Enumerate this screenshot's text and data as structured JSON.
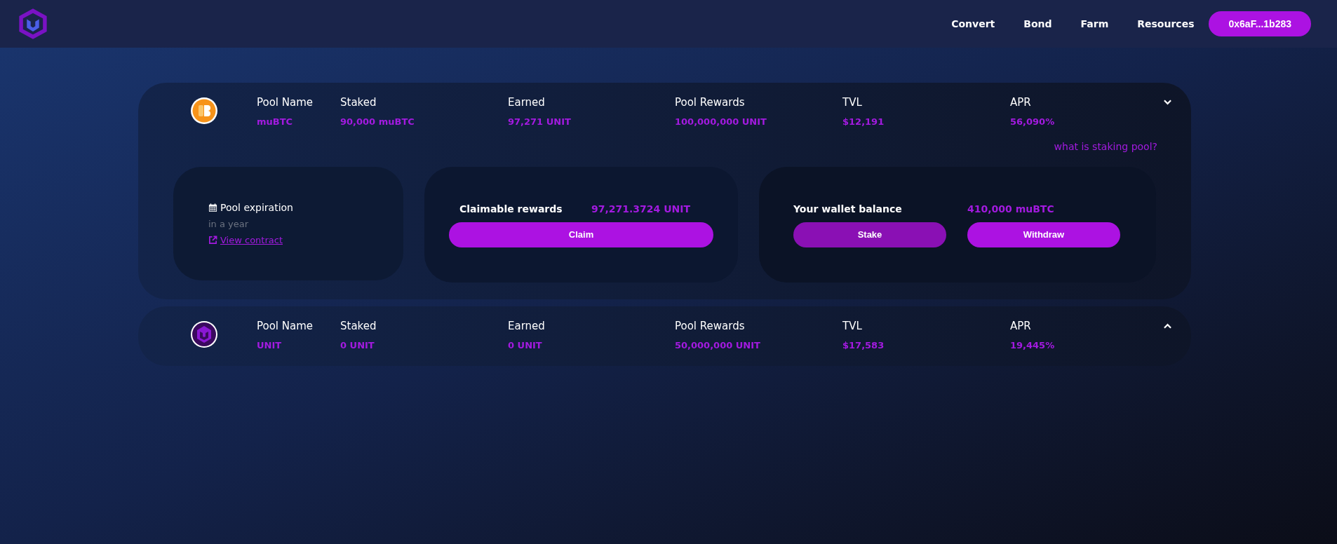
{
  "nav": {
    "links": [
      "Convert",
      "Bond",
      "Farm",
      "Resources"
    ],
    "wallet": "0x6aF...1b283"
  },
  "pools": [
    {
      "kind": "coin",
      "expanded": true,
      "stats": [
        {
          "label": "Pool Name",
          "value": "muBTC"
        },
        {
          "label": "Staked",
          "value": "90,000 muBTC"
        },
        {
          "label": "Earned",
          "value": "97,271 UNIT"
        },
        {
          "label": "Pool Rewards",
          "value": "100,000,000 UNIT"
        },
        {
          "label": "TVL",
          "value": "$12,191"
        },
        {
          "label": "APR",
          "value": "56,090%"
        }
      ],
      "help_link": "what is staking pool?",
      "expiration": {
        "label": "Pool expiration",
        "value": "in a year",
        "link": "View contract"
      },
      "claim": {
        "label": "Claimable rewards",
        "value": "97,271.3724 UNIT",
        "button": "Claim"
      },
      "wallet": {
        "label": "Your wallet balance",
        "value": "410,000 muBTC",
        "buttons": [
          {
            "label": "Stake",
            "kind": "muted"
          },
          {
            "label": "Withdraw",
            "kind": "solid"
          }
        ]
      }
    },
    {
      "kind": "logo",
      "expanded": false,
      "stats": [
        {
          "label": "Pool Name",
          "value": "UNIT"
        },
        {
          "label": "Staked",
          "value": "0 UNIT"
        },
        {
          "label": "Earned",
          "value": "0 UNIT"
        },
        {
          "label": "Pool Rewards",
          "value": "50,000,000 UNIT"
        },
        {
          "label": "TVL",
          "value": "$17,583"
        },
        {
          "label": "APR",
          "value": "19,445%"
        }
      ]
    }
  ]
}
